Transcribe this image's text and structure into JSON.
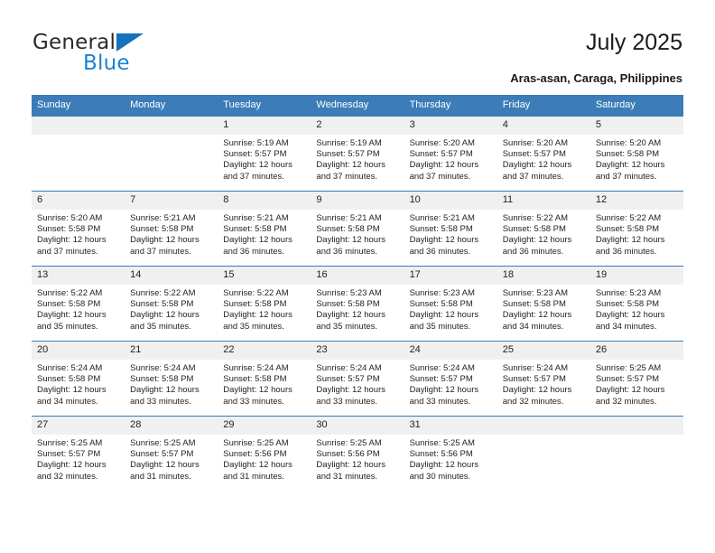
{
  "brand": {
    "name_part1": "General",
    "name_part2": "Blue",
    "triangle_color": "#1573bd",
    "blue_color": "#1c82d4"
  },
  "header": {
    "title": "July 2025",
    "location": "Aras-asan, Caraga, Philippines"
  },
  "theme": {
    "header_blue": "#3c7cb8",
    "daynum_band": "#f0f0f0",
    "text": "#232323"
  },
  "calendar": {
    "weekday_headers": [
      "Sunday",
      "Monday",
      "Tuesday",
      "Wednesday",
      "Thursday",
      "Friday",
      "Saturday"
    ],
    "labels": {
      "sunrise": "Sunrise:",
      "sunset": "Sunset:",
      "daylight": "Daylight:"
    },
    "weeks": [
      [
        {
          "day": "",
          "empty": true
        },
        {
          "day": "",
          "empty": true
        },
        {
          "day": "1",
          "sunrise": "Sunrise: 5:19 AM",
          "sunset": "Sunset: 5:57 PM",
          "daylight": "Daylight: 12 hours and 37 minutes."
        },
        {
          "day": "2",
          "sunrise": "Sunrise: 5:19 AM",
          "sunset": "Sunset: 5:57 PM",
          "daylight": "Daylight: 12 hours and 37 minutes."
        },
        {
          "day": "3",
          "sunrise": "Sunrise: 5:20 AM",
          "sunset": "Sunset: 5:57 PM",
          "daylight": "Daylight: 12 hours and 37 minutes."
        },
        {
          "day": "4",
          "sunrise": "Sunrise: 5:20 AM",
          "sunset": "Sunset: 5:57 PM",
          "daylight": "Daylight: 12 hours and 37 minutes."
        },
        {
          "day": "5",
          "sunrise": "Sunrise: 5:20 AM",
          "sunset": "Sunset: 5:58 PM",
          "daylight": "Daylight: 12 hours and 37 minutes."
        }
      ],
      [
        {
          "day": "6",
          "sunrise": "Sunrise: 5:20 AM",
          "sunset": "Sunset: 5:58 PM",
          "daylight": "Daylight: 12 hours and 37 minutes."
        },
        {
          "day": "7",
          "sunrise": "Sunrise: 5:21 AM",
          "sunset": "Sunset: 5:58 PM",
          "daylight": "Daylight: 12 hours and 37 minutes."
        },
        {
          "day": "8",
          "sunrise": "Sunrise: 5:21 AM",
          "sunset": "Sunset: 5:58 PM",
          "daylight": "Daylight: 12 hours and 36 minutes."
        },
        {
          "day": "9",
          "sunrise": "Sunrise: 5:21 AM",
          "sunset": "Sunset: 5:58 PM",
          "daylight": "Daylight: 12 hours and 36 minutes."
        },
        {
          "day": "10",
          "sunrise": "Sunrise: 5:21 AM",
          "sunset": "Sunset: 5:58 PM",
          "daylight": "Daylight: 12 hours and 36 minutes."
        },
        {
          "day": "11",
          "sunrise": "Sunrise: 5:22 AM",
          "sunset": "Sunset: 5:58 PM",
          "daylight": "Daylight: 12 hours and 36 minutes."
        },
        {
          "day": "12",
          "sunrise": "Sunrise: 5:22 AM",
          "sunset": "Sunset: 5:58 PM",
          "daylight": "Daylight: 12 hours and 36 minutes."
        }
      ],
      [
        {
          "day": "13",
          "sunrise": "Sunrise: 5:22 AM",
          "sunset": "Sunset: 5:58 PM",
          "daylight": "Daylight: 12 hours and 35 minutes."
        },
        {
          "day": "14",
          "sunrise": "Sunrise: 5:22 AM",
          "sunset": "Sunset: 5:58 PM",
          "daylight": "Daylight: 12 hours and 35 minutes."
        },
        {
          "day": "15",
          "sunrise": "Sunrise: 5:22 AM",
          "sunset": "Sunset: 5:58 PM",
          "daylight": "Daylight: 12 hours and 35 minutes."
        },
        {
          "day": "16",
          "sunrise": "Sunrise: 5:23 AM",
          "sunset": "Sunset: 5:58 PM",
          "daylight": "Daylight: 12 hours and 35 minutes."
        },
        {
          "day": "17",
          "sunrise": "Sunrise: 5:23 AM",
          "sunset": "Sunset: 5:58 PM",
          "daylight": "Daylight: 12 hours and 35 minutes."
        },
        {
          "day": "18",
          "sunrise": "Sunrise: 5:23 AM",
          "sunset": "Sunset: 5:58 PM",
          "daylight": "Daylight: 12 hours and 34 minutes."
        },
        {
          "day": "19",
          "sunrise": "Sunrise: 5:23 AM",
          "sunset": "Sunset: 5:58 PM",
          "daylight": "Daylight: 12 hours and 34 minutes."
        }
      ],
      [
        {
          "day": "20",
          "sunrise": "Sunrise: 5:24 AM",
          "sunset": "Sunset: 5:58 PM",
          "daylight": "Daylight: 12 hours and 34 minutes."
        },
        {
          "day": "21",
          "sunrise": "Sunrise: 5:24 AM",
          "sunset": "Sunset: 5:58 PM",
          "daylight": "Daylight: 12 hours and 33 minutes."
        },
        {
          "day": "22",
          "sunrise": "Sunrise: 5:24 AM",
          "sunset": "Sunset: 5:58 PM",
          "daylight": "Daylight: 12 hours and 33 minutes."
        },
        {
          "day": "23",
          "sunrise": "Sunrise: 5:24 AM",
          "sunset": "Sunset: 5:57 PM",
          "daylight": "Daylight: 12 hours and 33 minutes."
        },
        {
          "day": "24",
          "sunrise": "Sunrise: 5:24 AM",
          "sunset": "Sunset: 5:57 PM",
          "daylight": "Daylight: 12 hours and 33 minutes."
        },
        {
          "day": "25",
          "sunrise": "Sunrise: 5:24 AM",
          "sunset": "Sunset: 5:57 PM",
          "daylight": "Daylight: 12 hours and 32 minutes."
        },
        {
          "day": "26",
          "sunrise": "Sunrise: 5:25 AM",
          "sunset": "Sunset: 5:57 PM",
          "daylight": "Daylight: 12 hours and 32 minutes."
        }
      ],
      [
        {
          "day": "27",
          "sunrise": "Sunrise: 5:25 AM",
          "sunset": "Sunset: 5:57 PM",
          "daylight": "Daylight: 12 hours and 32 minutes."
        },
        {
          "day": "28",
          "sunrise": "Sunrise: 5:25 AM",
          "sunset": "Sunset: 5:57 PM",
          "daylight": "Daylight: 12 hours and 31 minutes."
        },
        {
          "day": "29",
          "sunrise": "Sunrise: 5:25 AM",
          "sunset": "Sunset: 5:56 PM",
          "daylight": "Daylight: 12 hours and 31 minutes."
        },
        {
          "day": "30",
          "sunrise": "Sunrise: 5:25 AM",
          "sunset": "Sunset: 5:56 PM",
          "daylight": "Daylight: 12 hours and 31 minutes."
        },
        {
          "day": "31",
          "sunrise": "Sunrise: 5:25 AM",
          "sunset": "Sunset: 5:56 PM",
          "daylight": "Daylight: 12 hours and 30 minutes."
        },
        {
          "day": "",
          "empty": true
        },
        {
          "day": "",
          "empty": true
        }
      ]
    ]
  }
}
